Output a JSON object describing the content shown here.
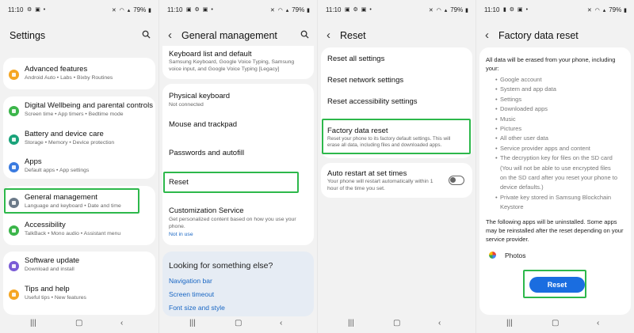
{
  "status": {
    "time": "11:10",
    "battery": "79%"
  },
  "colors": {
    "highlight": "#2db84b",
    "accent": "#1a6de0",
    "link": "#1a67c4"
  },
  "screen1": {
    "title": "Settings",
    "groups": [
      [
        {
          "icon": "advanced-features-icon",
          "color": "#f5a623",
          "title": "Advanced features",
          "subtitle": "Android Auto  •  Labs  •  Bixby Routines"
        }
      ],
      [
        {
          "icon": "digital-wellbeing-icon",
          "color": "#3bb54a",
          "title": "Digital Wellbeing and parental controls",
          "subtitle": "Screen time  •  App timers  •  Bedtime mode"
        },
        {
          "icon": "battery-care-icon",
          "color": "#1aa37a",
          "title": "Battery and device care",
          "subtitle": "Storage  •  Memory  •  Device protection"
        },
        {
          "icon": "apps-icon",
          "color": "#3b7be0",
          "title": "Apps",
          "subtitle": "Default apps  •  App settings"
        }
      ],
      [
        {
          "icon": "general-management-icon",
          "color": "#6c7a89",
          "title": "General management",
          "subtitle": "Language and keyboard  •  Date and time"
        },
        {
          "icon": "accessibility-icon",
          "color": "#3bb54a",
          "title": "Accessibility",
          "subtitle": "TalkBack  •  Mono audio  •  Assistant menu"
        }
      ],
      [
        {
          "icon": "software-update-icon",
          "color": "#7b5cd6",
          "title": "Software update",
          "subtitle": "Download and install"
        },
        {
          "icon": "tips-help-icon",
          "color": "#f5a623",
          "title": "Tips and help",
          "subtitle": "Useful tips  •  New features"
        }
      ]
    ]
  },
  "screen2": {
    "title": "General management",
    "rows": [
      {
        "title": "Keyboard list and default",
        "subtitle_lines": [
          "Samsung Keyboard, Google Voice Typing, Samsung",
          "voice input, and Google Voice Typing [Legacy]"
        ]
      },
      {
        "title": "Physical keyboard",
        "subtitle_lines": [
          "Not connected"
        ]
      },
      {
        "title": "Mouse and trackpad",
        "subtitle_lines": []
      },
      {
        "title": "Passwords and autofill",
        "subtitle_lines": []
      },
      {
        "title": "Reset",
        "subtitle_lines": []
      },
      {
        "title": "Customization Service",
        "subtitle_lines": [
          "Get personalized content based on how you use your",
          "phone."
        ],
        "link": "Not in use"
      }
    ],
    "looking": {
      "question": "Looking for something else?",
      "links": [
        "Navigation bar",
        "Screen timeout",
        "Font size and style"
      ]
    }
  },
  "screen3": {
    "title": "Reset",
    "rows": [
      {
        "title": "Reset all settings"
      },
      {
        "title": "Reset network settings"
      },
      {
        "title": "Reset accessibility settings"
      },
      {
        "title": "Factory data reset",
        "subtitle_lines": [
          "Reset your phone to its factory default settings. This will",
          "erase all data, including files and downloaded apps."
        ]
      },
      {
        "title": "Auto restart at set times",
        "subtitle_lines": [
          "Your phone will restart automatically within 1",
          "hour of the time you set."
        ],
        "toggle_on": false
      }
    ]
  },
  "screen4": {
    "title": "Factory data reset",
    "intro": "All data will be erased from your phone, including your:",
    "items": [
      "Google account",
      "System and app data",
      "Settings",
      "Downloaded apps",
      "Music",
      "Pictures",
      "All other user data",
      "Service provider apps and content",
      "The decryption key for files on the SD card",
      "(You will not be able to use encrypted files",
      "on the SD card after you reset your phone to",
      "device defaults.)",
      "Private key stored in Samsung Blockchain",
      "Keystore"
    ],
    "note": "The following apps will be uninstalled. Some apps may be reinstalled after the reset depending on your service provider.",
    "app": "Photos",
    "button": "Reset"
  }
}
